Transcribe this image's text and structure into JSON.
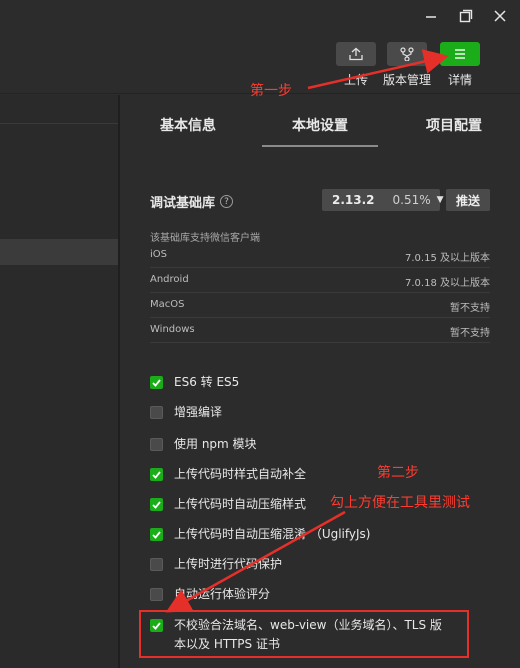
{
  "toolbar": {
    "upload_label": "上传",
    "version_label": "版本管理",
    "details_label": "详情"
  },
  "tabs": [
    {
      "label": "基本信息"
    },
    {
      "label": "本地设置"
    },
    {
      "label": "项目配置"
    }
  ],
  "settings": {
    "debug_lib_label": "调试基础库",
    "version": "2.13.2",
    "percent": "0.51%",
    "push_label": "推送",
    "support_desc": "该基础库支持微信客户端",
    "support": [
      {
        "os": "iOS",
        "value": "7.0.15 及以上版本"
      },
      {
        "os": "Android",
        "value": "7.0.18 及以上版本"
      },
      {
        "os": "MacOS",
        "value": "暂不支持"
      },
      {
        "os": "Windows",
        "value": "暂不支持"
      }
    ],
    "options": [
      {
        "label": "ES6 转 ES5",
        "checked": true
      },
      {
        "label": "增强编译",
        "checked": false
      },
      {
        "label": "使用 npm 模块",
        "checked": false
      },
      {
        "label": "上传代码时样式自动补全",
        "checked": true
      },
      {
        "label": "上传代码时自动压缩样式",
        "checked": true
      },
      {
        "label": "上传代码时自动压缩混淆 （UglifyJs)",
        "checked": true
      },
      {
        "label": "上传时进行代码保护",
        "checked": false
      },
      {
        "label": "自动运行体验评分",
        "checked": false
      },
      {
        "label": "不校验合法域名、web-view（业务域名）、TLS 版本以及 HTTPS 证书",
        "checked": true
      }
    ]
  },
  "annotations": {
    "step1": "第一步",
    "step2": "第二步",
    "note": "勾上方便在工具里测试",
    "color": "#e5302a"
  },
  "colors": {
    "accent_green": "#1aad19",
    "background": "#2c2c2c"
  }
}
